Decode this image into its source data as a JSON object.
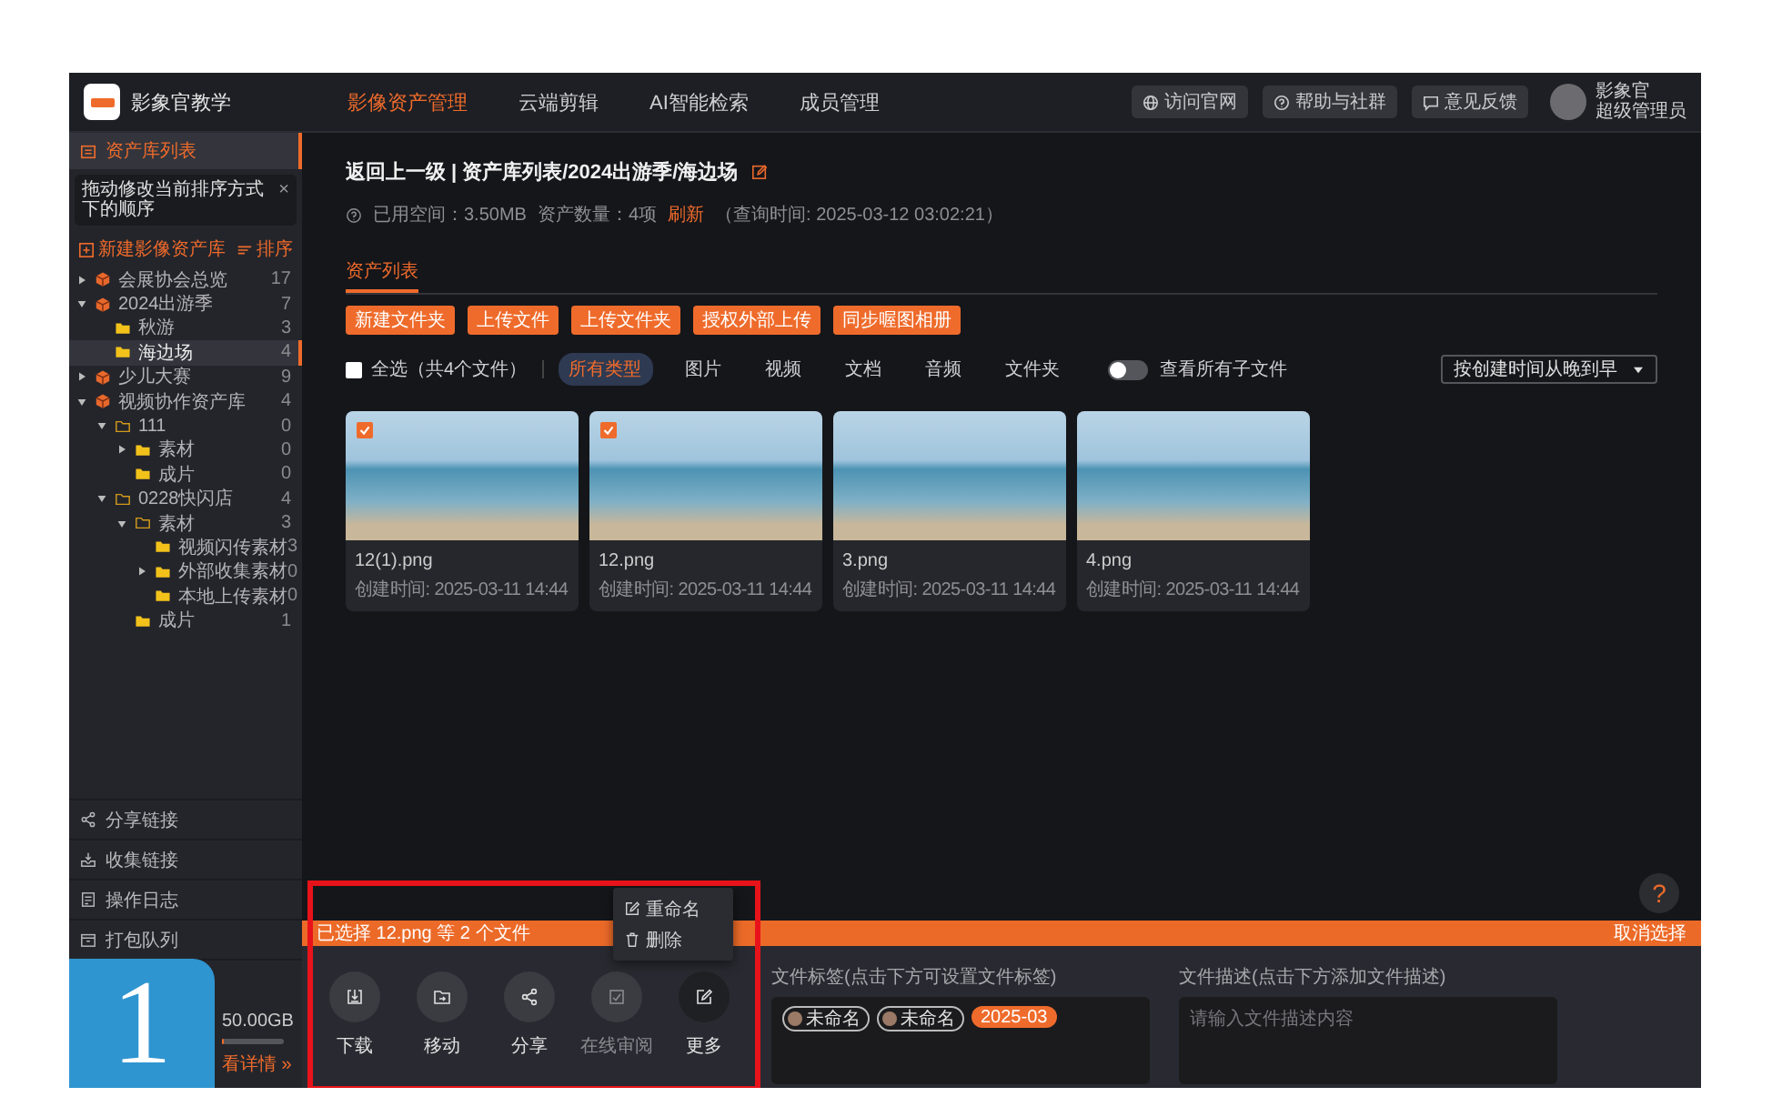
{
  "topbar": {
    "app_name": "影象官教学",
    "nav": [
      {
        "label": "影像资产管理",
        "selected": true
      },
      {
        "label": "云端剪辑",
        "selected": false
      },
      {
        "label": "AI智能检索",
        "selected": false
      },
      {
        "label": "成员管理",
        "selected": false
      }
    ],
    "buttons": [
      {
        "kind": "globe",
        "label": "访问官网"
      },
      {
        "kind": "help",
        "label": "帮助与社群"
      },
      {
        "kind": "feedback",
        "label": "意见反馈"
      }
    ],
    "user": {
      "name": "影象官",
      "role": "超级管理员"
    }
  },
  "sidebar": {
    "header": "资产库列表",
    "tooltip": {
      "text": "拖动修改当前排序方式下的顺序",
      "close": "×"
    },
    "new_library": "新建影像资产库",
    "sort": "排序",
    "tree": [
      {
        "kind": "library",
        "label": "会展协会总览",
        "count": "17",
        "expanded": false,
        "selected": false
      },
      {
        "kind": "library",
        "label": "2024出游季",
        "count": "7",
        "expanded": true,
        "selected": false,
        "children": [
          {
            "kind": "folder",
            "label": "秋游",
            "count": "3",
            "selected": false
          },
          {
            "kind": "folder",
            "label": "海边场",
            "count": "4",
            "selected": true
          }
        ]
      },
      {
        "kind": "library",
        "label": "少儿大赛",
        "count": "9",
        "expanded": false,
        "selected": false
      },
      {
        "kind": "library",
        "label": "视频协作资产库",
        "count": "4",
        "expanded": true,
        "selected": false,
        "children": [
          {
            "kind": "group",
            "label": "111",
            "count": "0",
            "expanded": true,
            "selected": false,
            "children": [
              {
                "kind": "folder",
                "label": "素材",
                "count": "0",
                "expanded": false,
                "selected": false
              },
              {
                "kind": "folder",
                "label": "成片",
                "count": "0",
                "selected": false
              }
            ]
          },
          {
            "kind": "group",
            "label": "0228快闪店",
            "count": "4",
            "expanded": true,
            "selected": false,
            "children": [
              {
                "kind": "group",
                "label": "素材",
                "count": "3",
                "expanded": true,
                "selected": false,
                "children": [
                  {
                    "kind": "folder",
                    "label": "视频闪传素材",
                    "count": "3",
                    "selected": false
                  },
                  {
                    "kind": "folder",
                    "label": "外部收集素材",
                    "count": "0",
                    "expanded": false,
                    "selected": false
                  },
                  {
                    "kind": "folder",
                    "label": "本地上传素材",
                    "count": "0",
                    "selected": false
                  }
                ]
              },
              {
                "kind": "folder",
                "label": "成片",
                "count": "1",
                "selected": false
              }
            ]
          }
        ]
      }
    ],
    "menu": [
      {
        "kind": "share",
        "label": "分享链接"
      },
      {
        "kind": "collect",
        "label": "收集链接"
      },
      {
        "kind": "log",
        "label": "操作日志"
      },
      {
        "kind": "package",
        "label": "打包队列"
      }
    ],
    "storage": {
      "total": "50.00GB",
      "level": 0.03,
      "details": "看详情 »"
    }
  },
  "main": {
    "breadcrumb": {
      "back": "返回上一级",
      "separator": "|",
      "path": "资产库列表/2024出游季/海边场"
    },
    "info": {
      "used": "已用空间：3.50MB",
      "count": "资产数量：4项",
      "refresh": "刷新",
      "query_time": "（查询时间: 2025-03-12 03:02:21）"
    },
    "tabs": [
      {
        "label": "资产列表",
        "selected": true
      }
    ],
    "buttons": [
      "新建文件夹",
      "上传文件",
      "上传文件夹",
      "授权外部上传",
      "同步喔图相册"
    ],
    "filters": {
      "select_all": {
        "label": "全选（共4个文件）",
        "checked": false
      },
      "types": [
        {
          "label": "所有类型",
          "selected": true
        },
        {
          "label": "图片",
          "selected": false
        },
        {
          "label": "视频",
          "selected": false
        },
        {
          "label": "文档",
          "selected": false
        },
        {
          "label": "音频",
          "selected": false
        },
        {
          "label": "文件夹",
          "selected": false
        }
      ],
      "subfiles_toggle": {
        "label": "查看所有子文件",
        "on": false
      },
      "sort": "按创建时间从晚到早"
    },
    "files": [
      {
        "name": "12(1).png",
        "created": "创建时间: 2025-03-11 14:44",
        "checked": true
      },
      {
        "name": "12.png",
        "created": "创建时间: 2025-03-11 14:44",
        "checked": true
      },
      {
        "name": "3.png",
        "created": "创建时间: 2025-03-11 14:44",
        "checked": false
      },
      {
        "name": "4.png",
        "created": "创建时间: 2025-03-11 14:44",
        "checked": false
      }
    ],
    "help": "?"
  },
  "selection_panel": {
    "summary": "已选择 12.png 等 2 个文件",
    "cancel": "取消选择",
    "actions": [
      {
        "kind": "download",
        "label": "下载",
        "disabled": false,
        "selected": false
      },
      {
        "kind": "move",
        "label": "移动",
        "disabled": false,
        "selected": false
      },
      {
        "kind": "share",
        "label": "分享",
        "disabled": false,
        "selected": false
      },
      {
        "kind": "review",
        "label": "在线审阅",
        "disabled": true,
        "selected": false
      },
      {
        "kind": "more",
        "label": "更多",
        "disabled": false,
        "selected": true
      }
    ],
    "more_menu": [
      {
        "kind": "rename",
        "label": "重命名"
      },
      {
        "kind": "delete",
        "label": "删除"
      }
    ],
    "tags": {
      "title": "文件标签(点击下方可设置文件标签)",
      "items": [
        {
          "kind": "person",
          "label": "未命名"
        },
        {
          "kind": "person",
          "label": "未命名"
        },
        {
          "kind": "date",
          "label": "2025-03"
        }
      ]
    },
    "description": {
      "title": "文件描述(点击下方添加文件描述)",
      "placeholder": "请输入文件描述内容"
    }
  },
  "step_badge": "1"
}
